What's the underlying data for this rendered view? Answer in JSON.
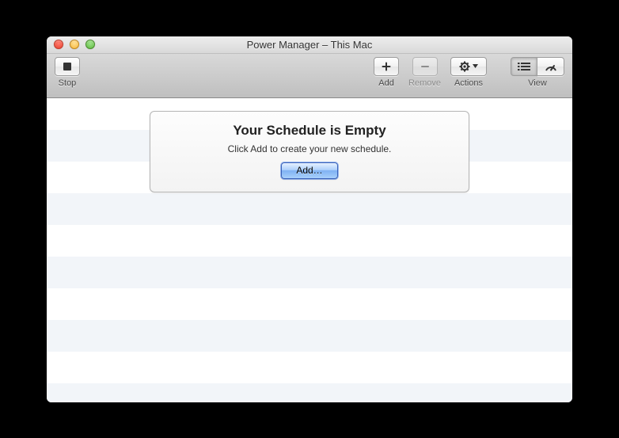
{
  "window": {
    "title": "Power Manager – This Mac"
  },
  "toolbar": {
    "stop_label": "Stop",
    "add_label": "Add",
    "remove_label": "Remove",
    "actions_label": "Actions",
    "view_label": "View"
  },
  "empty_state": {
    "heading": "Your Schedule is Empty",
    "subtext": "Click Add to create your new schedule.",
    "button_label": "Add…"
  }
}
